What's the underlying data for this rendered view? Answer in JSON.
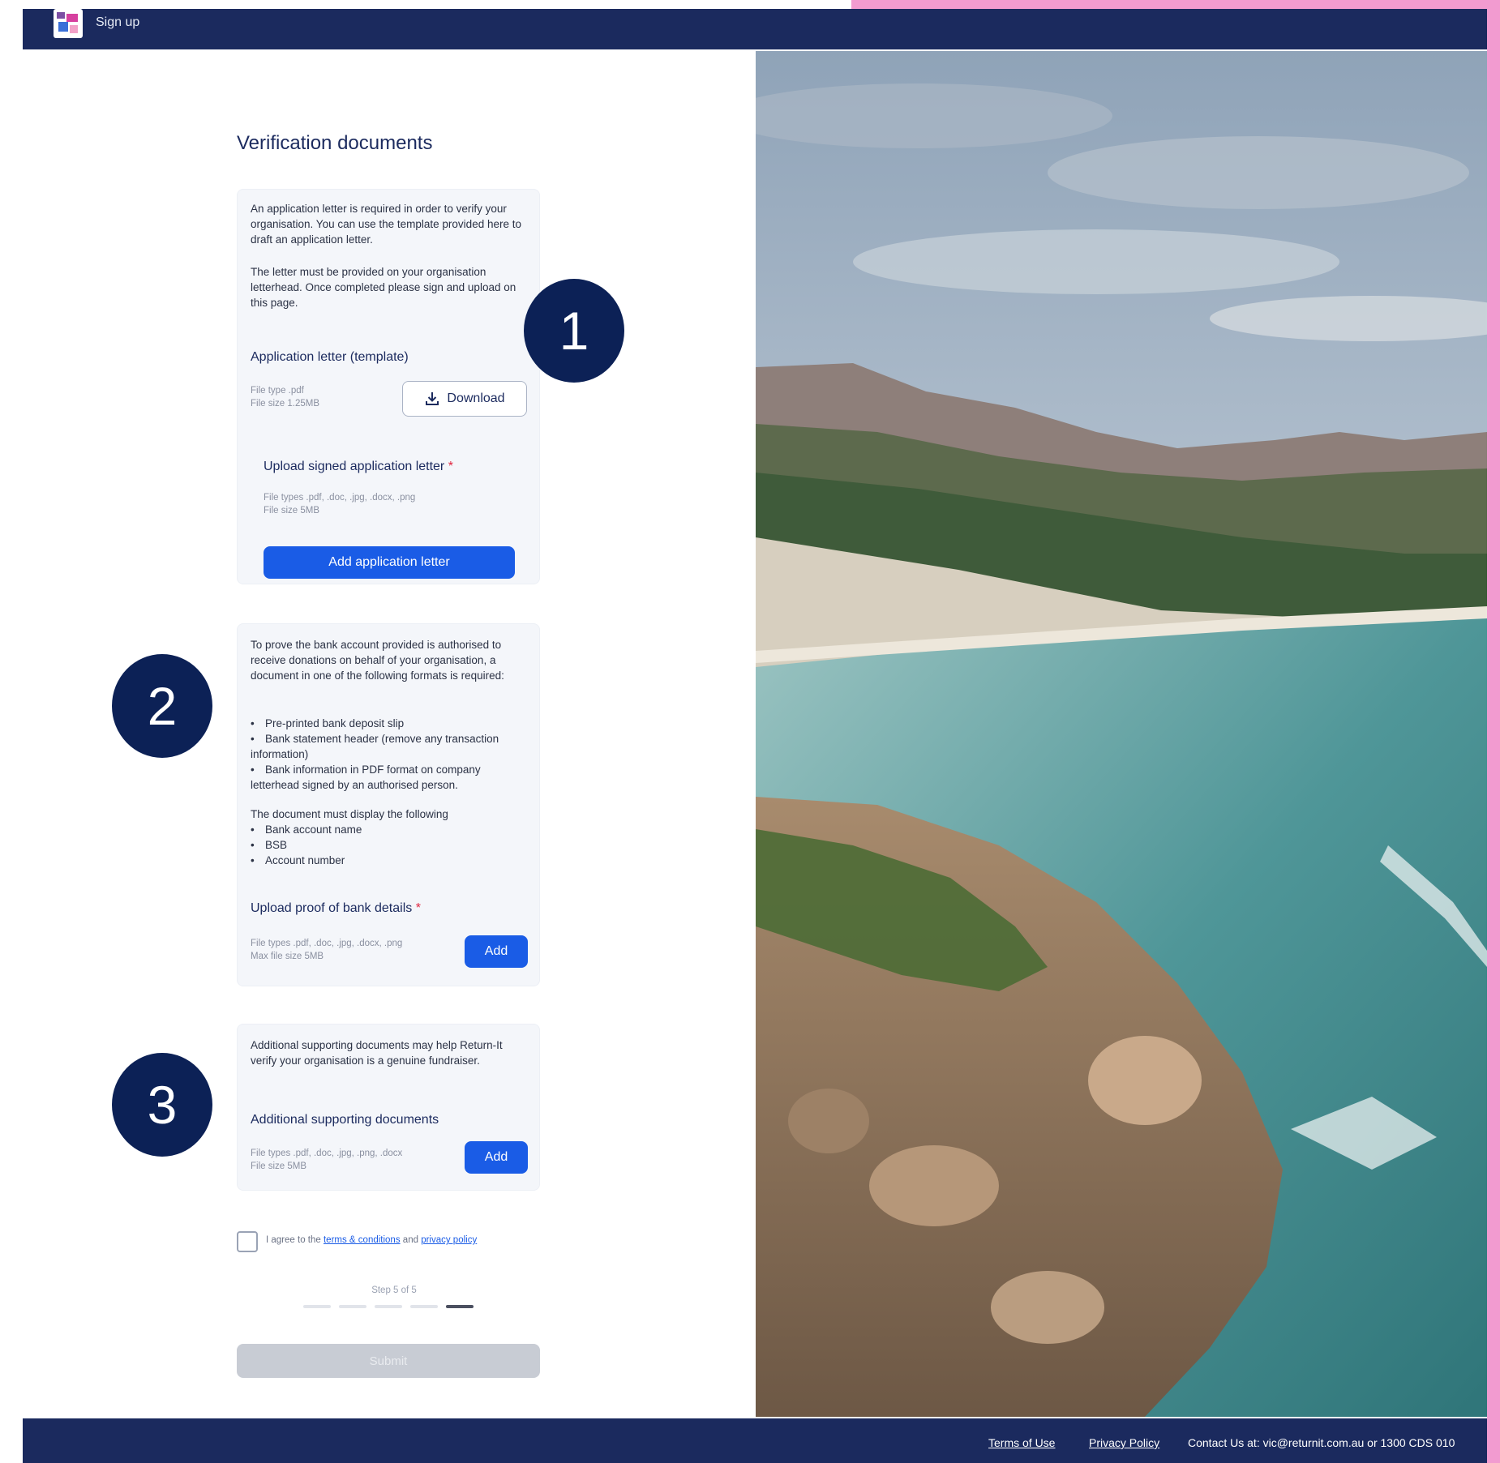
{
  "header": {
    "title": "Sign up"
  },
  "page": {
    "title": "Verification documents"
  },
  "section1": {
    "intro_p1": "An application letter is required in order to verify your organisation. You can use the template provided here to draft an application letter.",
    "intro_p2": "The letter must be provided on your organisation letterhead. Once completed please sign and upload on this page.",
    "template_label": "Application letter (template)",
    "template_file_type": "File type .pdf",
    "template_file_size": "File size 1.25MB",
    "download_label": "Download",
    "upload_label": "Upload signed application letter",
    "required_mark": "*",
    "upload_file_types": "File types .pdf, .doc, .jpg, .docx, .png",
    "upload_file_size": "File size 5MB",
    "add_button": "Add application letter"
  },
  "section2": {
    "intro": "To prove the bank account provided is authorised to receive donations on behalf of your organisation, a document in one of the following formats is required:",
    "formats": [
      "Pre-printed bank deposit slip",
      "Bank statement header (remove any transaction information)",
      "Bank information in PDF format on company letterhead signed by an authorised person."
    ],
    "display_intro": "The document must display the following",
    "display_items": [
      "Bank account name",
      "BSB",
      "Account number"
    ],
    "upload_label": "Upload proof of bank details",
    "required_mark": "*",
    "file_types": "File types .pdf, .doc, .jpg, .docx, .png",
    "file_size": "Max file size 5MB",
    "add_button": "Add"
  },
  "section3": {
    "intro": "Additional supporting documents may help Return-It verify your organisation is a genuine fundraiser.",
    "upload_label": "Additional supporting documents",
    "file_types": "File types .pdf, .doc, .jpg, .png, .docx",
    "file_size": "File size 5MB",
    "add_button": "Add"
  },
  "badges": [
    "1",
    "2",
    "3"
  ],
  "agreement": {
    "prefix": "I agree to the",
    "terms_link": "terms & conditions",
    "and": "and",
    "privacy_link": "privacy policy"
  },
  "stepper": {
    "label": "Step 5 of 5",
    "total": 5,
    "current": 5
  },
  "submit_label": "Submit",
  "footer": {
    "terms": "Terms of Use",
    "privacy": "Privacy Policy",
    "contact": "Contact Us at: vic@returnit.com.au or 1300 CDS 010"
  },
  "colors": {
    "navy": "#1b2a5e",
    "primary": "#1a5ce6",
    "badge": "#0c2156",
    "accent_pink": "#f29bd0"
  },
  "icons": [
    "download-icon",
    "brand-logo"
  ]
}
